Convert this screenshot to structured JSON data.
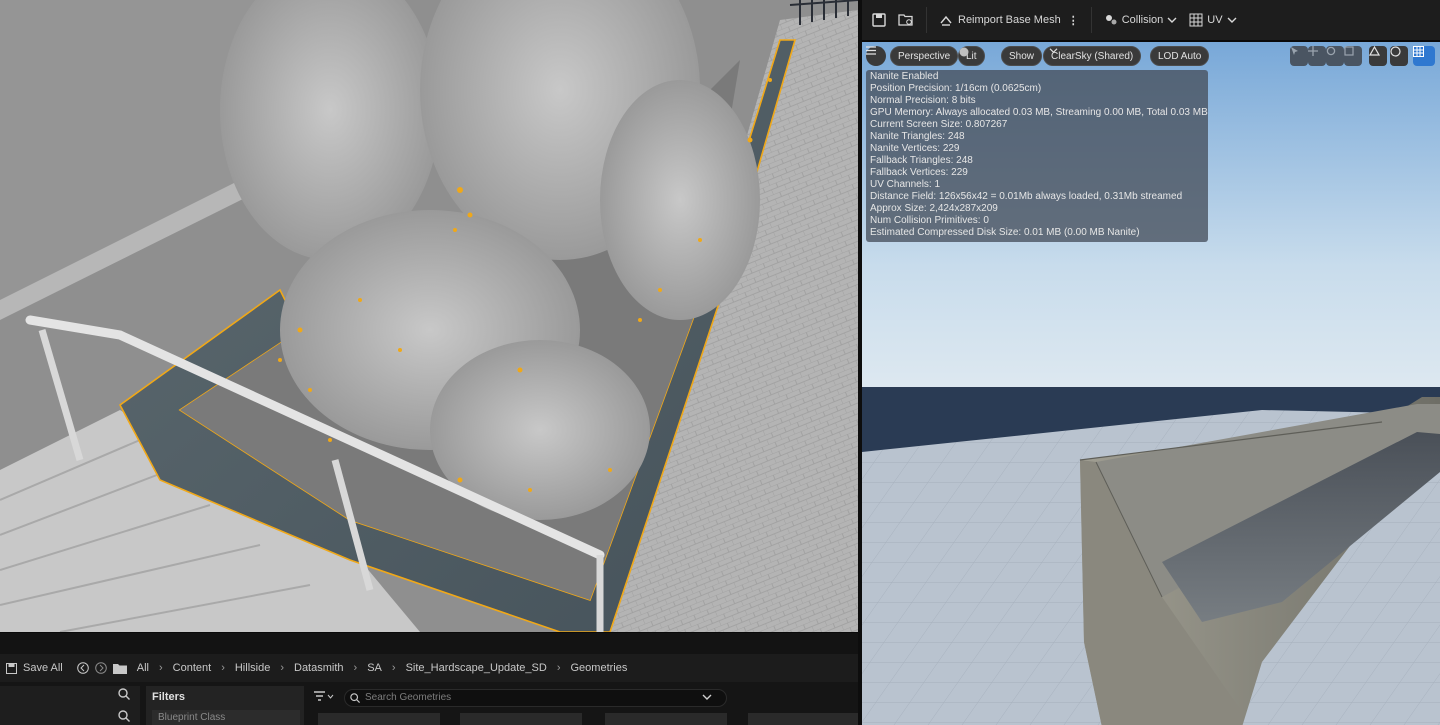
{
  "mesh_toolbar": {
    "save_icon": "save-icon",
    "browse_icon": "browse-to-asset-icon",
    "reimport_label": "Reimport Base Mesh",
    "collision_label": "Collision",
    "uv_label": "UV"
  },
  "mesh_viewport": {
    "menu_icon": "hamburger-menu-icon",
    "perspective_label": "Perspective",
    "lit_label": "Lit",
    "show_label": "Show",
    "sky_label": "ClearSky (Shared)",
    "lod_label": "LOD Auto",
    "stats": [
      "Nanite Enabled",
      "Position Precision: 1/16cm (0.0625cm)",
      "Normal Precision: 8 bits",
      "GPU Memory: Always allocated 0.03 MB, Streaming 0.00 MB, Total 0.03 MB",
      "Current Screen Size: 0.807267",
      "Nanite Triangles: 248",
      "Nanite Vertices: 229",
      "Fallback Triangles: 248",
      "Fallback Vertices: 229",
      "UV Channels: 1",
      "Distance Field: 126x56x42 = 0.01Mb always loaded, 0.31Mb streamed",
      "Approx Size: 2,424x287x209",
      "Num Collision Primitives: 0",
      "Estimated Compressed Disk Size: 0.01 MB (0.00 MB Nanite)"
    ],
    "grid_icon_value": "1"
  },
  "content_browser": {
    "save_all_label": "Save All",
    "breadcrumbs": [
      "All",
      "Content",
      "Hillside",
      "Datasmith",
      "SA",
      "Site_Hardscape_Update_SD",
      "Geometries"
    ],
    "filters_label": "Filters",
    "blueprint_class_label": "Blueprint Class",
    "search_placeholder": "Search Geometries"
  },
  "colors": {
    "selection_outline": "#f0a818",
    "accent_blue": "#2f78d0",
    "toolbar_bg": "#1d1d1d"
  }
}
